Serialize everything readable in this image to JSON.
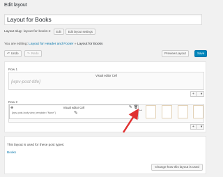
{
  "page": {
    "title": "Edit layout"
  },
  "layout_title": {
    "value": "Layout for Books"
  },
  "slug": {
    "label": "Layout slug:",
    "value": "layout-for-books-2",
    "edit_label": "Edit",
    "settings_label": "Edit layout settings"
  },
  "editing": {
    "prefix": "You are editing:",
    "parent_link": "Layout for Header and Footer",
    "separator": "»",
    "current": "Layout for Books"
  },
  "toolbar": {
    "undo_label": "Undo",
    "redo_label": "Redo",
    "preview_label": "Preview Layout",
    "save_label": "Save",
    "undo_icon": "undo-icon",
    "redo_icon": "redo-icon"
  },
  "rows": [
    {
      "label": "Row 1",
      "cell": {
        "title": "Visual editor Cell",
        "content": "[wpv-post-title]"
      },
      "add_label": "+"
    },
    {
      "label": "Row 2",
      "cell": {
        "title": "Visual editor Cell",
        "content": "[wpv-post-body view_template=\"None\"]"
      },
      "add_label": "+"
    }
  ],
  "info": {
    "text": "This layout is used for these post types:",
    "post_type": "Books",
    "change_button": "Change how this layout is used"
  },
  "colors": {
    "accent": "#0073aa",
    "primary_button": "#0085ba",
    "arrow": "#e03131"
  }
}
